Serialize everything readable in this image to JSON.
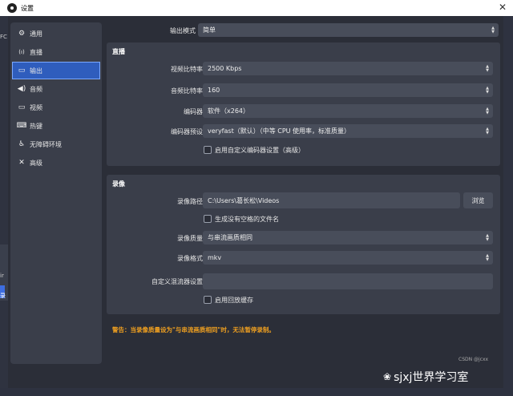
{
  "window": {
    "title": "设置",
    "close_label": "✕"
  },
  "background": {
    "fragment_1": "FC",
    "fragment_2": "ir",
    "fragment_3": "录"
  },
  "sidebar": {
    "items": [
      {
        "label": "通用",
        "icon": "gear-icon",
        "glyph": "⚙",
        "active": false
      },
      {
        "label": "直播",
        "icon": "antenna-icon",
        "glyph": "((ı))",
        "active": false
      },
      {
        "label": "输出",
        "icon": "output-icon",
        "glyph": "▭",
        "active": true
      },
      {
        "label": "音频",
        "icon": "speaker-icon",
        "glyph": "🔊",
        "active": false
      },
      {
        "label": "视频",
        "icon": "monitor-icon",
        "glyph": "▭",
        "active": false
      },
      {
        "label": "热键",
        "icon": "keyboard-icon",
        "glyph": "⌨",
        "active": false
      },
      {
        "label": "无障碍环境",
        "icon": "accessibility-icon",
        "glyph": "♿",
        "active": false
      },
      {
        "label": "高级",
        "icon": "tools-icon",
        "glyph": "✕",
        "active": false
      }
    ]
  },
  "output_mode": {
    "label": "输出模式",
    "value": "简单"
  },
  "streaming": {
    "title": "直播",
    "video_bitrate": {
      "label": "视频比特率",
      "value": "2500 Kbps"
    },
    "audio_bitrate": {
      "label": "音频比特率",
      "value": "160"
    },
    "encoder": {
      "label": "编码器",
      "value": "软件（x264）"
    },
    "encoder_preset": {
      "label": "编码器预设",
      "value": "veryfast（默认）（中等 CPU 使用率，标准质量）"
    },
    "advanced_checkbox": {
      "label": "启用自定义编码器设置（高级）",
      "checked": false
    }
  },
  "recording": {
    "title": "录像",
    "path": {
      "label": "录像路径",
      "value": "C:\\Users\\葛长松\\Videos",
      "browse_label": "浏览"
    },
    "no_space_checkbox": {
      "label": "生成没有空格的文件名",
      "checked": false
    },
    "quality": {
      "label": "录像质量",
      "value": "与串流画质相同"
    },
    "format": {
      "label": "录像格式",
      "value": "mkv"
    },
    "muxer": {
      "label": "自定义混流器设置",
      "value": ""
    },
    "replay_checkbox": {
      "label": "启用回放缓存",
      "checked": false
    }
  },
  "warning": "警告：当录像质量设为\"与串流画质相同\"时，无法暂停录制。",
  "watermark": {
    "text": "sjxj世界学习室",
    "source": "CSDN @jcxx"
  }
}
